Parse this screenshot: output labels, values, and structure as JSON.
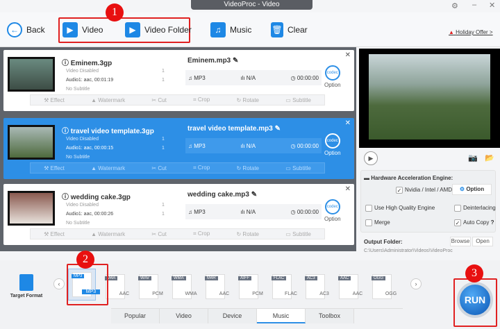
{
  "window": {
    "title": "VideoProc - Video",
    "settings_icon": "gear-icon",
    "minimize": "–",
    "close": "✕"
  },
  "toolbar": {
    "back": "Back",
    "video": "Video",
    "video_folder": "Video Folder",
    "music": "Music",
    "clear": "Clear",
    "holiday": "Holiday Offer >"
  },
  "annotations": [
    "1",
    "2",
    "3"
  ],
  "items": [
    {
      "name": "Eminem.3gp",
      "video": "Video Disabled",
      "audio": "Audio1: aac, 00:01:19",
      "subtitle": "No Subtitle",
      "v_count": "1",
      "a_count": "1",
      "output": "Eminem.mp3",
      "format": "MP3",
      "bitrate": "N/A",
      "duration": "00:00:00"
    },
    {
      "name": "travel video template.3gp",
      "video": "Video Disabled",
      "audio": "Audio1: aac, 00:00:15",
      "subtitle": "No Subtitle",
      "v_count": "1",
      "a_count": "1",
      "output": "travel video template.mp3",
      "format": "MP3",
      "bitrate": "N/A",
      "duration": "00:00:00"
    },
    {
      "name": "wedding cake.3gp",
      "video": "Video Disabled",
      "audio": "Audio1: aac, 00:00:26",
      "subtitle": "No Subtitle",
      "v_count": "1",
      "a_count": "1",
      "output": "wedding cake.mp3",
      "format": "MP3",
      "bitrate": "N/A",
      "duration": "00:00:00"
    }
  ],
  "item_labels": {
    "option": "Option",
    "codec": "codec",
    "effect": "Effect",
    "watermark": "Watermark",
    "cut": "Cut",
    "crop": "Crop",
    "rotate": "Rotate",
    "subtitle": "Subtitle"
  },
  "settings": {
    "hw_title": "Hardware Acceleration Engine:",
    "hw_option": "Nvidia / Intel / AMD",
    "option_btn": "Option",
    "high_quality": "Use High Quality Engine",
    "deinterlacing": "Deinterlacing",
    "merge": "Merge",
    "auto_copy": "Auto Copy",
    "help": "?",
    "output_label": "Output Folder:",
    "browse": "Browse",
    "open": "Open",
    "output_path": "C:\\Users\\Administrator\\Videos\\VideoProc"
  },
  "target_format": "Target Format",
  "formats": [
    {
      "tag": "MP3",
      "sub": "MP3"
    },
    {
      "tag": "M4A",
      "sub": "AAC"
    },
    {
      "tag": "WAV",
      "sub": "PCM"
    },
    {
      "tag": "WMA",
      "sub": "WMA"
    },
    {
      "tag": "M4R",
      "sub": "AAC"
    },
    {
      "tag": "AIFF",
      "sub": "PCM"
    },
    {
      "tag": "FLAC",
      "sub": "FLAC"
    },
    {
      "tag": "AC3",
      "sub": "AC3"
    },
    {
      "tag": "AAC",
      "sub": "AAC"
    },
    {
      "tag": "OGG",
      "sub": "OGG"
    }
  ],
  "tabs": [
    "Popular",
    "Video",
    "Device",
    "Music",
    "Toolbox"
  ],
  "run": "RUN",
  "colors": {
    "accent": "#2d8fe6",
    "annotation": "#e81010"
  }
}
